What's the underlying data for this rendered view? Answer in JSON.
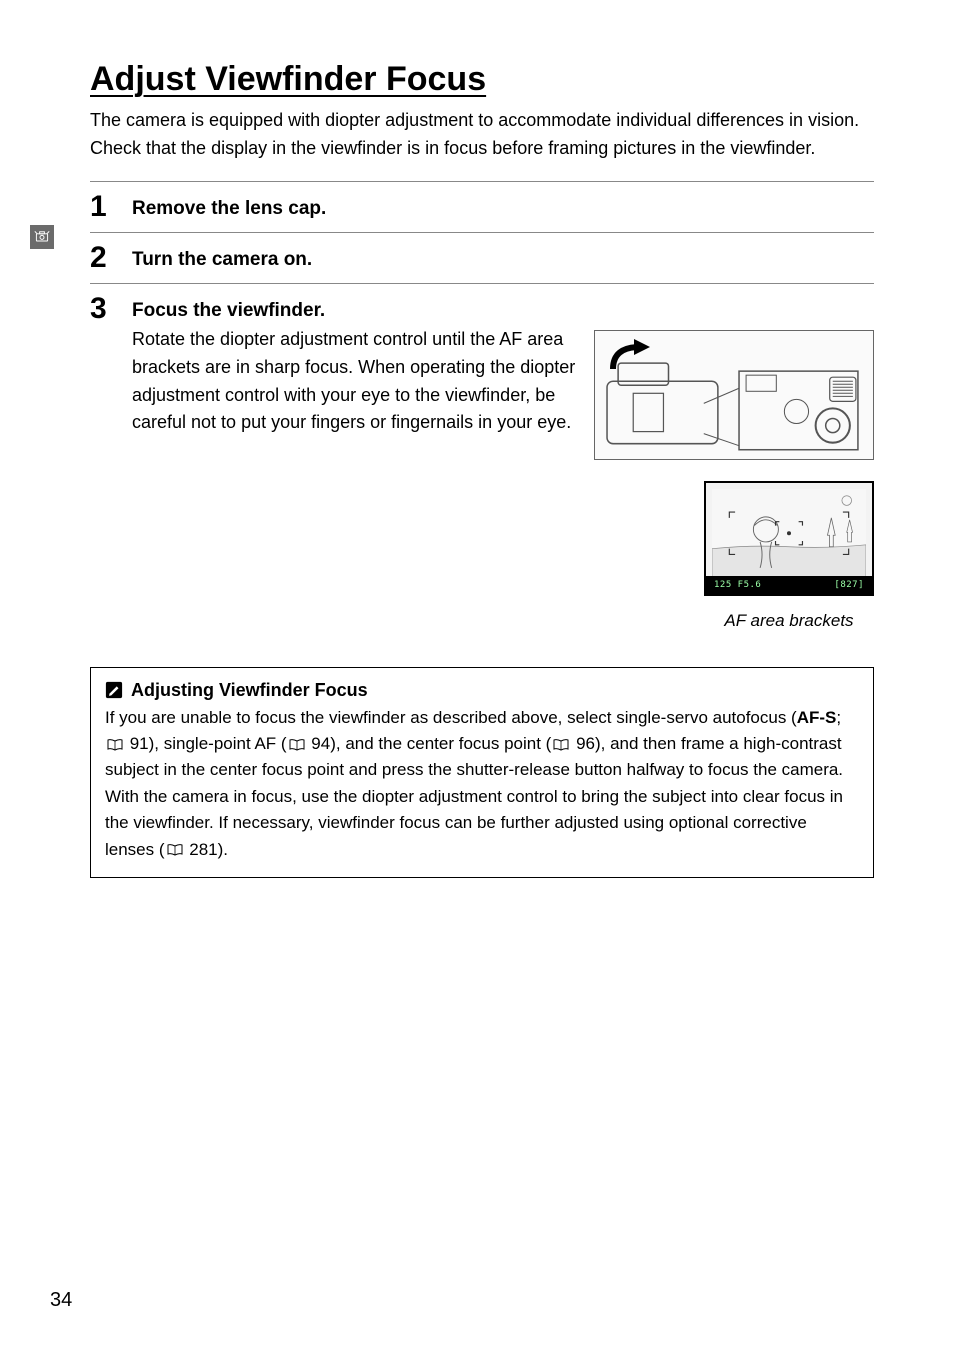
{
  "title": "Adjust Viewfinder Focus",
  "intro": "The camera is equipped with diopter adjustment to accommodate individual differences in vision.  Check that the display in the viewfinder is in focus before framing pictures in the viewfinder.",
  "steps": [
    {
      "num": "1",
      "title": "Remove the lens cap.",
      "body": ""
    },
    {
      "num": "2",
      "title": "Turn the camera on.",
      "body": ""
    },
    {
      "num": "3",
      "title": "Focus the viewfinder.",
      "body": "Rotate the diopter adjustment control until the AF area brackets are in sharp focus. When operating the diopter adjustment control with your eye to the viewfinder, be careful not to put your fingers or fingernails in your eye."
    }
  ],
  "viewfinder": {
    "left_readout": "125  F5.6",
    "right_readout": "827",
    "caption": "AF area brackets"
  },
  "note": {
    "title": "Adjusting Viewfinder Focus",
    "body_prefix": "If you are unable to focus the viewfinder as described above, select single-servo autofocus (",
    "af_label": "AF-S",
    "body_rest": "; 0 91), single-point AF (0 94), and the center focus point (0 96), and then frame a high-contrast subject in the center focus point and press the shutter-release button halfway to focus the camera.  With the camera in focus, use the diopter adjustment control to bring the subject into clear focus in the viewfinder.  If necessary, viewfinder focus can be further adjusted using optional corrective lenses (0 281).",
    "refs": {
      "r1": " 91), single-point AF (",
      "r2": " 94), and the center focus point (",
      "r3": " 96), and then frame a high-contrast subject in the center focus point and press the shutter-release button halfway to focus the camera.  With the camera in focus, use the diopter adjustment control to bring the subject into clear focus in the viewfinder.  If necessary, viewfinder focus can be further adjusted using optional corrective lenses (",
      "r4": " 281)."
    },
    "semicolon": "; "
  },
  "page_number": "34"
}
